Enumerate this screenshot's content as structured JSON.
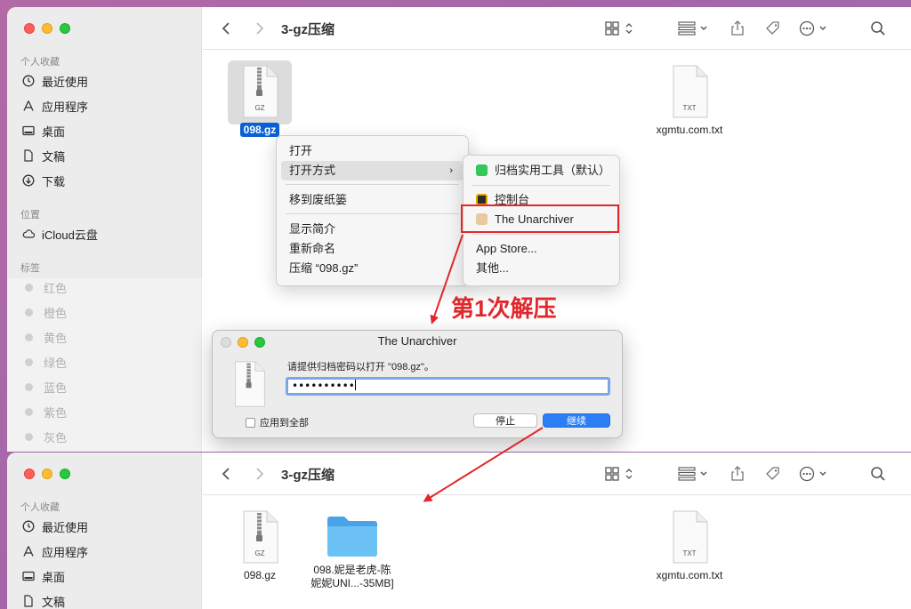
{
  "window_top": {
    "title": "3-gz压缩",
    "sidebar": {
      "favorites_header": "个人收藏",
      "items": [
        "最近使用",
        "应用程序",
        "桌面",
        "文稿",
        "下载"
      ],
      "locations_header": "位置",
      "locations": [
        "iCloud云盘"
      ],
      "tags_header": "标签",
      "tags": [
        "红色",
        "橙色",
        "黄色",
        "绿色",
        "蓝色",
        "紫色",
        "灰色"
      ]
    },
    "files": [
      {
        "name": "098.gz",
        "type_label": "GZ"
      },
      {
        "name": "xgmtu.com.txt",
        "type_label": "TXT"
      }
    ]
  },
  "context_menu": {
    "items": [
      "打开",
      "打开方式",
      "移到废纸篓",
      "显示简介",
      "重新命名",
      "压缩 “098.gz”"
    ],
    "submenu_arrow": "›",
    "submenu": [
      "归档实用工具（默认）",
      "控制台",
      "The Unarchiver",
      "App Store...",
      "其他..."
    ]
  },
  "annotation": "第1次解压",
  "dialog": {
    "title": "The Unarchiver",
    "prompt": "请提供归档密码以打开 \"098.gz\"。",
    "password_value": "••••••••••",
    "apply_all": "应用到全部",
    "stop_button": "停止",
    "continue_button": "继续"
  },
  "window_bottom": {
    "title": "3-gz压缩",
    "sidebar": {
      "favorites_header": "个人收藏",
      "items": [
        "最近使用",
        "应用程序",
        "桌面",
        "文稿"
      ]
    },
    "files": [
      {
        "name": "098.gz",
        "type_label": "GZ"
      },
      {
        "name_line1": "098.妮是老虎-陈",
        "name_line2": "妮妮UNI...-35MB]"
      },
      {
        "name": "xgmtu.com.txt",
        "type_label": "TXT"
      }
    ]
  },
  "colors": {
    "accent": "#0a5fd6",
    "annotation_red": "#e0282c",
    "folder_blue": "#5ab4ee"
  }
}
